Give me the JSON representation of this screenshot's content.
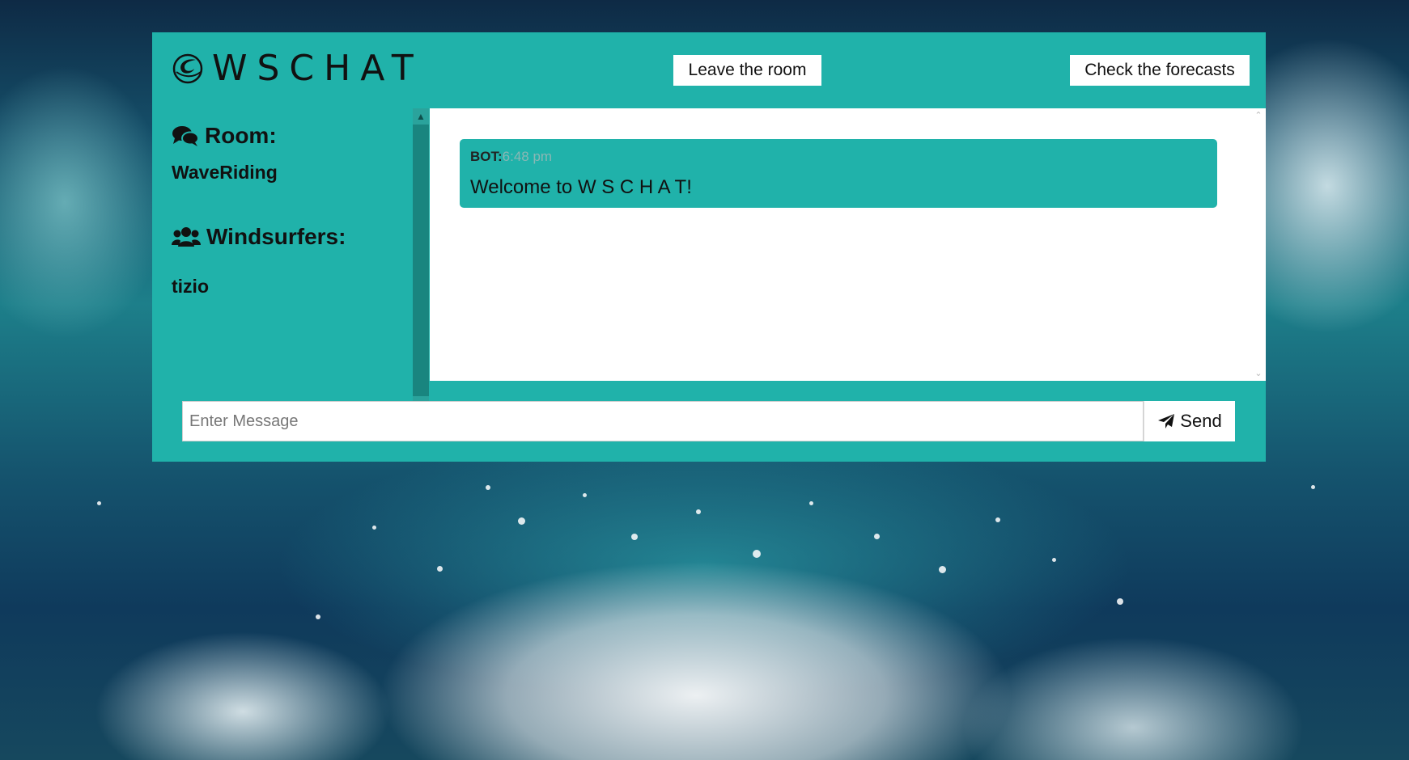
{
  "app": {
    "logo_text": "WSCHAT"
  },
  "header": {
    "leave_label": "Leave the room",
    "forecast_label": "Check the forecasts"
  },
  "sidebar": {
    "room_heading": "Room:",
    "room_name": "WaveRiding",
    "users_heading": "Windsurfers:",
    "users": [
      "tizio"
    ]
  },
  "chat": {
    "messages": [
      {
        "author": "BOT:",
        "time": "6:48 pm",
        "text": "Welcome to W S C H A T!"
      }
    ]
  },
  "composer": {
    "placeholder": "Enter Message",
    "value": "",
    "send_label": "Send"
  },
  "icons": {
    "logo": "globe-swirl-icon",
    "room": "comments-icon",
    "users": "users-icon",
    "send": "paper-plane-icon",
    "scroll_up": "chevron-up-icon",
    "scroll_down": "chevron-down-icon"
  },
  "colors": {
    "accent": "#20b2aa",
    "accent_dark": "#19857f",
    "time_text": "#8ab7b4"
  }
}
